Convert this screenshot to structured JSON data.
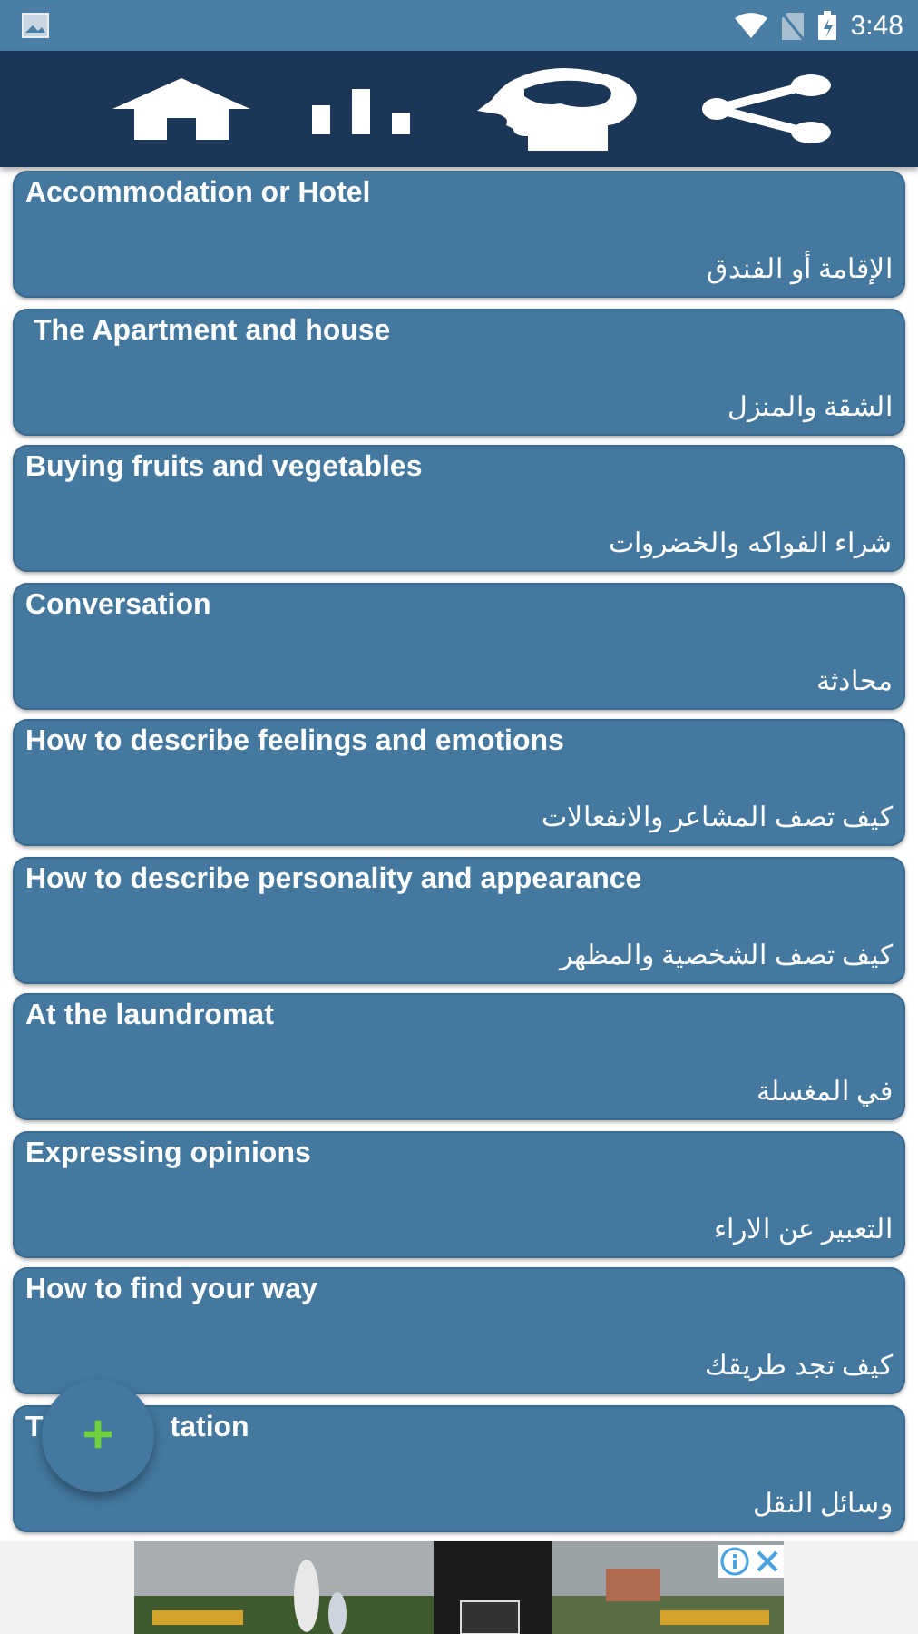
{
  "status_bar": {
    "time": "3:48"
  },
  "items": [
    {
      "kind": "plain",
      "title": "Accommodation or Hotel",
      "subtitle": "الإقامة أو الفندق"
    },
    {
      "kind": "plain",
      "title": " The Apartment and house",
      "subtitle": "الشقة والمنزل"
    },
    {
      "kind": "plain",
      "title": "Buying fruits and vegetables",
      "subtitle": "شراء الفواكه والخضروات"
    },
    {
      "kind": "plain",
      "title": "Conversation",
      "subtitle": "محادثة"
    },
    {
      "kind": "plain",
      "title": "How to describe feelings and emotions",
      "subtitle": "كيف تصف المشاعر والانفعالات"
    },
    {
      "kind": "plain",
      "title": "How to describe personality and appearance",
      "subtitle": "كيف تصف الشخصية والمظهر"
    },
    {
      "kind": "plain",
      "title": "At the laundromat",
      "subtitle": "في المغسلة"
    },
    {
      "kind": "plain",
      "title": "Expressing opinions",
      "subtitle": "التعبير عن الاراء"
    },
    {
      "kind": "plain",
      "title": "How to find your way",
      "subtitle": "كيف تجد طريقك"
    },
    {
      "kind": "covered",
      "title": "T",
      "title_end": "tation",
      "subtitle": "وسائل النقل"
    }
  ],
  "fab": {
    "label": "+"
  }
}
